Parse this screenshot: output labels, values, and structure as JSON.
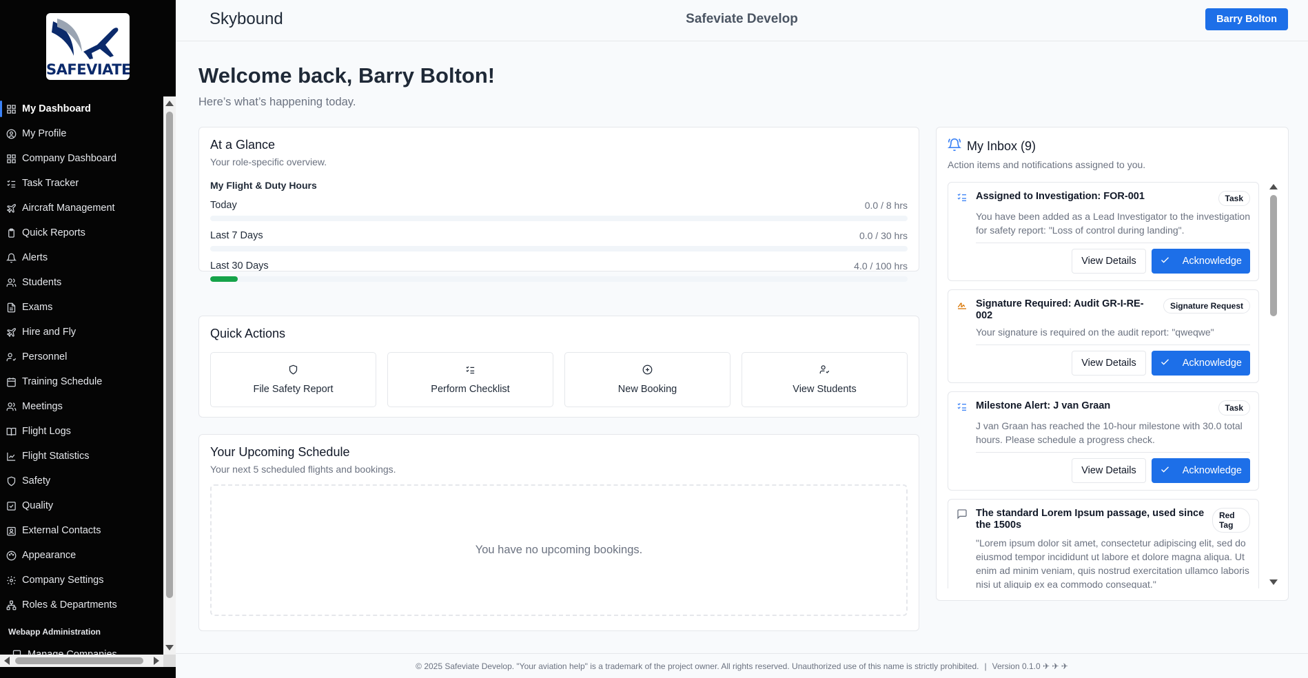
{
  "logo": {
    "text": "SAFEVIATE"
  },
  "sidebar": {
    "items": [
      {
        "label": "My Dashboard",
        "icon": "grid-icon",
        "active": true
      },
      {
        "label": "My Profile",
        "icon": "user-circle-icon"
      },
      {
        "label": "Company Dashboard",
        "icon": "grid-icon"
      },
      {
        "label": "Task Tracker",
        "icon": "list-check-icon"
      },
      {
        "label": "Aircraft Management",
        "icon": "plane-icon"
      },
      {
        "label": "Quick Reports",
        "icon": "clipboard-icon"
      },
      {
        "label": "Alerts",
        "icon": "bell-icon"
      },
      {
        "label": "Students",
        "icon": "users-icon"
      },
      {
        "label": "Exams",
        "icon": "file-text-icon"
      },
      {
        "label": "Hire and Fly",
        "icon": "plane-icon"
      },
      {
        "label": "Personnel",
        "icon": "user-check-icon"
      },
      {
        "label": "Training Schedule",
        "icon": "calendar-icon"
      },
      {
        "label": "Meetings",
        "icon": "users-icon"
      },
      {
        "label": "Flight Logs",
        "icon": "book-icon"
      },
      {
        "label": "Flight Statistics",
        "icon": "chart-icon"
      },
      {
        "label": "Safety",
        "icon": "shield-icon"
      },
      {
        "label": "Quality",
        "icon": "check-square-icon"
      },
      {
        "label": "External Contacts",
        "icon": "contact-icon"
      },
      {
        "label": "Appearance",
        "icon": "palette-icon"
      },
      {
        "label": "Company Settings",
        "icon": "gear-icon"
      },
      {
        "label": "Roles & Departments",
        "icon": "hierarchy-icon"
      }
    ],
    "section_label": "Webapp Administration",
    "admin_items": [
      {
        "label": "Manage Companies",
        "icon": "building-icon"
      }
    ]
  },
  "header": {
    "app_name": "Skybound",
    "org_name": "Safeviate Develop",
    "user_button": "Barry Bolton"
  },
  "welcome": {
    "title": "Welcome back, Barry Bolton!",
    "subtitle": "Here’s what’s happening today."
  },
  "glance": {
    "title": "At a Glance",
    "subtitle": "Your role-specific overview.",
    "duty_heading": "My Flight & Duty Hours",
    "rows": [
      {
        "label": "Today",
        "value": "0.0 / 8 hrs",
        "progress": 0.0
      },
      {
        "label": "Last 7 Days",
        "value": "0.0 / 30 hrs",
        "progress": 0.0
      },
      {
        "label": "Last 30 Days",
        "value": "4.0 / 100 hrs",
        "progress": 0.04
      }
    ],
    "accent": "#16a34a"
  },
  "quick_actions": {
    "title": "Quick Actions",
    "buttons": [
      {
        "label": "File Safety Report",
        "icon": "shield-icon"
      },
      {
        "label": "Perform Checklist",
        "icon": "list-check-icon"
      },
      {
        "label": "New Booking",
        "icon": "plus-circle-icon"
      },
      {
        "label": "View Students",
        "icon": "user-check-icon"
      }
    ]
  },
  "schedule": {
    "title": "Your Upcoming Schedule",
    "subtitle": "Your next 5 scheduled flights and bookings.",
    "empty_text": "You have no upcoming bookings."
  },
  "inbox": {
    "title": "My Inbox (9)",
    "subtitle": "Action items and notifications assigned to you.",
    "view_label": "View Details",
    "ack_label": "Acknowledge",
    "messages": [
      {
        "icon": "list-check-icon",
        "title": "Assigned to Investigation: FOR-001",
        "badge": "Task",
        "body": "You have been added as a Lead Investigator to the investigation for safety report: \"Loss of control during landing\"."
      },
      {
        "icon": "signature-icon",
        "title": "Signature Required: Audit GR-I-RE-002",
        "badge": "Signature Request",
        "body": "Your signature is required on the audit report: \"qweqwe\""
      },
      {
        "icon": "list-check-icon",
        "title": "Milestone Alert: J van Graan",
        "badge": "Task",
        "body": "J van Graan has reached the 10-hour milestone with 30.0 total hours. Please schedule a progress check."
      },
      {
        "icon": "message-icon",
        "title": "The standard Lorem Ipsum passage, used since the 1500s",
        "badge": "Red Tag",
        "body": "\"Lorem ipsum dolor sit amet, consectetur adipiscing elit, sed do eiusmod tempor incididunt ut labore et dolore magna aliqua. Ut enim ad minim veniam, quis nostrud exercitation ullamco laboris nisi ut aliquip ex ea commodo consequat.\""
      }
    ]
  },
  "footer": {
    "copyright": "© 2025 Safeviate Develop. \"Your aviation help\" is a trademark of the project owner. All rights reserved. Unauthorized use of this name is strictly prohibited.",
    "separator": "|",
    "version": "Version 0.1.0 ✈ ✈ ✈"
  },
  "colors": {
    "primary": "#1d6fe8",
    "sidebar_bg": "#050505",
    "success": "#16a34a"
  }
}
